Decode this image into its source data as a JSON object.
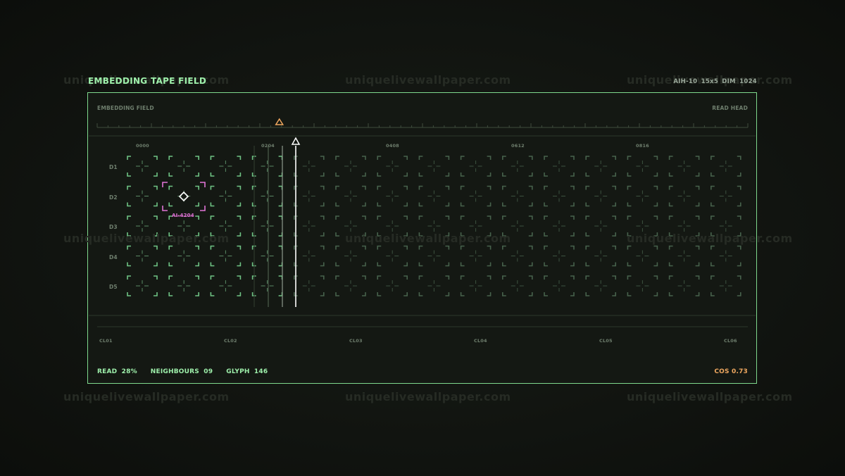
{
  "watermark": "uniquelivewallpaper.com",
  "header": {
    "title": "EMBEDDING TAPE FIELD",
    "meta": "AIH-10  15x5  DIM 1024"
  },
  "panel": {
    "field_label": "EMBEDDING FIELD",
    "read_head_label": "READ HEAD"
  },
  "columns_top": [
    "0000",
    "0204",
    "0408",
    "0612",
    "0816"
  ],
  "rows": [
    "D1",
    "D2",
    "D3",
    "D4",
    "D5"
  ],
  "grid": {
    "cols": 15,
    "rows": 5,
    "selected_col": 2,
    "selected_row": 2
  },
  "selected_id": "AI-4204",
  "clusters": [
    "CL01",
    "CL02",
    "CL03",
    "CL04",
    "CL05",
    "CL06"
  ],
  "status": {
    "read": "READ 28%",
    "neighbours": "NEIGHBOURS 09",
    "glyph": "GLYPH 146",
    "cos": "COS 0.73"
  },
  "read_progress": 0.28,
  "colors": {
    "accent": "#7fd98d",
    "selection": "#e074d6",
    "marker": "#f0a860",
    "cell_bright": "#6fc384",
    "cell_dim": "#47624c"
  }
}
